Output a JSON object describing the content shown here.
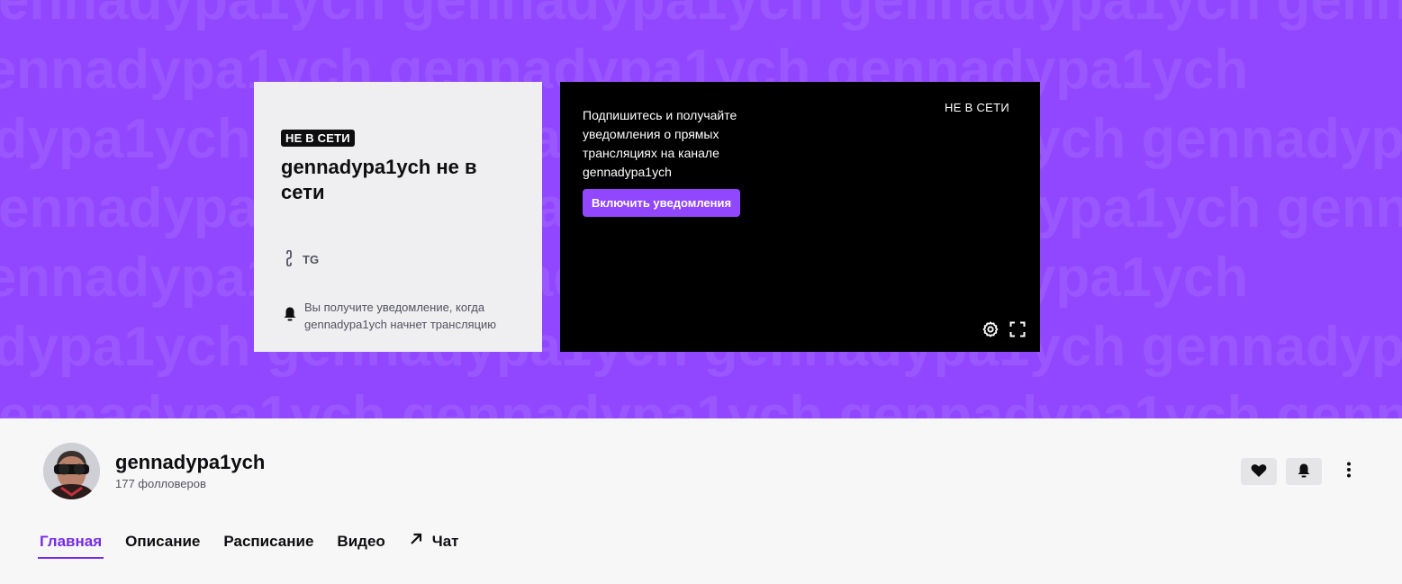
{
  "banner": {
    "pattern_text": "gennadypa1ych gennadypa1ych gennadypa1ych gennadypa1ych",
    "color": "#9147ff"
  },
  "offline_card": {
    "badge": "НЕ В СЕТИ",
    "title": "gennadypa1ych не в сети",
    "link_label": "TG",
    "notify_text": "Вы получите уведомление, когда gennadypa1ych начнет трансляцию"
  },
  "player": {
    "message": "Подпишитесь и получайте уведомления о прямых трансляциях на канале gennadypa1ych",
    "button_label": "Включить уведомления",
    "status": "НЕ В СЕТИ"
  },
  "channel": {
    "name": "gennadypa1ych",
    "followers": "177 фолловеров"
  },
  "tabs": [
    {
      "label": "Главная",
      "active": true
    },
    {
      "label": "Описание"
    },
    {
      "label": "Расписание"
    },
    {
      "label": "Видео"
    },
    {
      "label": "Чат"
    }
  ],
  "colors": {
    "accent": "#9147ff",
    "tab_active": "#772ce8"
  }
}
